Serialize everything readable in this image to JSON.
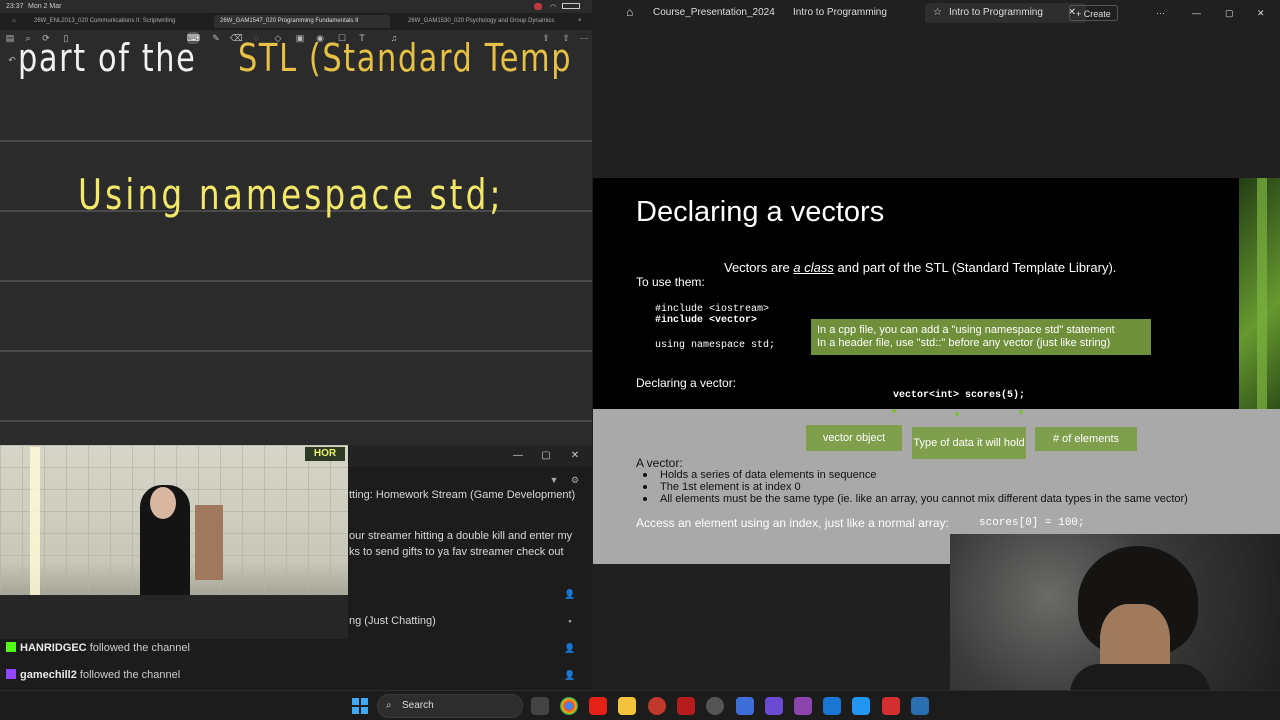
{
  "notes": {
    "status_time": "23:37",
    "status_date": "Mon 2 Mar",
    "tabs": [
      "26W_ENL2013_020 Communications II: Scriptwriting",
      "26W_GAM1547_020 Programming Fundamentals II",
      "26W_GAM1530_020 Psychology and Group Dynamics"
    ],
    "handwriting_top_white": "part of the",
    "handwriting_top_yellow": "STL (Standard Temp",
    "handwriting_namespace": "Using namespace std;"
  },
  "chat": {
    "line1": "tting: Homework Stream (Game Development)",
    "line2": "our streamer hitting a double kill and enter my",
    "line3": "ks to send gifts to ya fav streamer check out",
    "line4": "ng (Just Chatting)",
    "follows": [
      {
        "user": "HANRIDGEC",
        "text": "followed the channel"
      },
      {
        "user": "gamechill2",
        "text": "followed the channel"
      }
    ],
    "cam_logo": "HOR"
  },
  "viewer": {
    "tabs": [
      "Course_Presentation_2024",
      "Intro to Programming",
      "Intro to Programming"
    ],
    "create_label": "Create",
    "more_label": "···"
  },
  "slide": {
    "title": "Declaring a vectors",
    "subtitle_pre": "Vectors are ",
    "subtitle_em": "a class",
    "subtitle_post": " and part of the STL (Standard Template Library).",
    "to_use": "To use them:",
    "code1": "#include <iostream>",
    "code2": "#include <vector>",
    "code3": "using namespace std;",
    "note1": "In a cpp file, you can add a \"using namespace std\" statement",
    "note2": "In a header file, use \"std::\" before any vector (just like string)",
    "declaring": "Declaring a vector:",
    "decl_code": "vector<int> scores(5);",
    "box_object": "vector object",
    "box_type": "Type of data it will hold",
    "box_elements": "# of elements",
    "a_vector": "A vector:",
    "bullets": [
      "Holds a series of data elements in sequence",
      "The 1st element is at index 0",
      "All elements must be the same type (ie. like an array, you cannot mix different data types in the same vector)"
    ],
    "access": "Access an element using an index, just like a normal array:",
    "access_code": "scores[0] = 100;"
  },
  "taskbar": {
    "search_label": "Search",
    "apps": [
      "file-explorer",
      "chrome",
      "youtube",
      "folder",
      "obs",
      "news",
      "settings",
      "visual-studio",
      "visual-studio-code",
      "outlook",
      "vscode-blue",
      "notepad",
      "pdf-reader",
      "app"
    ]
  },
  "colors": {
    "slide_green": "#7f9f4d",
    "note_green": "#6f8f3a",
    "hand_yellow": "#f3e76a",
    "accent_blue": "#3fa9f5"
  }
}
